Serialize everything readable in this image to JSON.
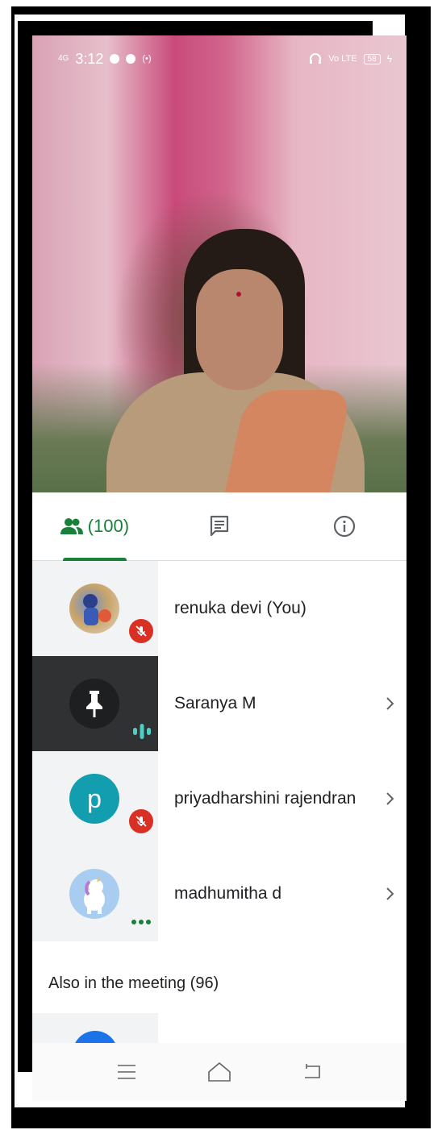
{
  "status_bar": {
    "network": "4G",
    "time": "3:12",
    "right_icons": [
      "headphones-icon",
      "volte-icon",
      "battery-icon",
      "charging-icon"
    ],
    "volte": "Vo LTE",
    "battery_level": "58"
  },
  "tabs": [
    {
      "name": "people",
      "label": "(100)",
      "icon": "people-icon",
      "selected": true
    },
    {
      "name": "chat",
      "icon": "chat-icon",
      "selected": false
    },
    {
      "name": "info",
      "icon": "info-icon",
      "selected": false
    }
  ],
  "participants": [
    {
      "name": "renuka devi (You)",
      "avatar": "photo",
      "status": "muted",
      "chevron": false
    },
    {
      "name": "Saranya M",
      "avatar": "photo",
      "status": "speaking",
      "chevron": true,
      "highlighted": true
    },
    {
      "name": "priyadharshini rajendran",
      "avatar_letter": "p",
      "status": "muted",
      "chevron": true
    },
    {
      "name": "madhumitha d",
      "avatar": "photo",
      "status": "more",
      "chevron": true
    }
  ],
  "section": {
    "label": "Also in the meeting (96)"
  },
  "colors": {
    "accent": "#188038",
    "mute_red": "#d93025",
    "avatar_teal": "#129eaf",
    "speaking_teal": "#4ecdc4"
  }
}
